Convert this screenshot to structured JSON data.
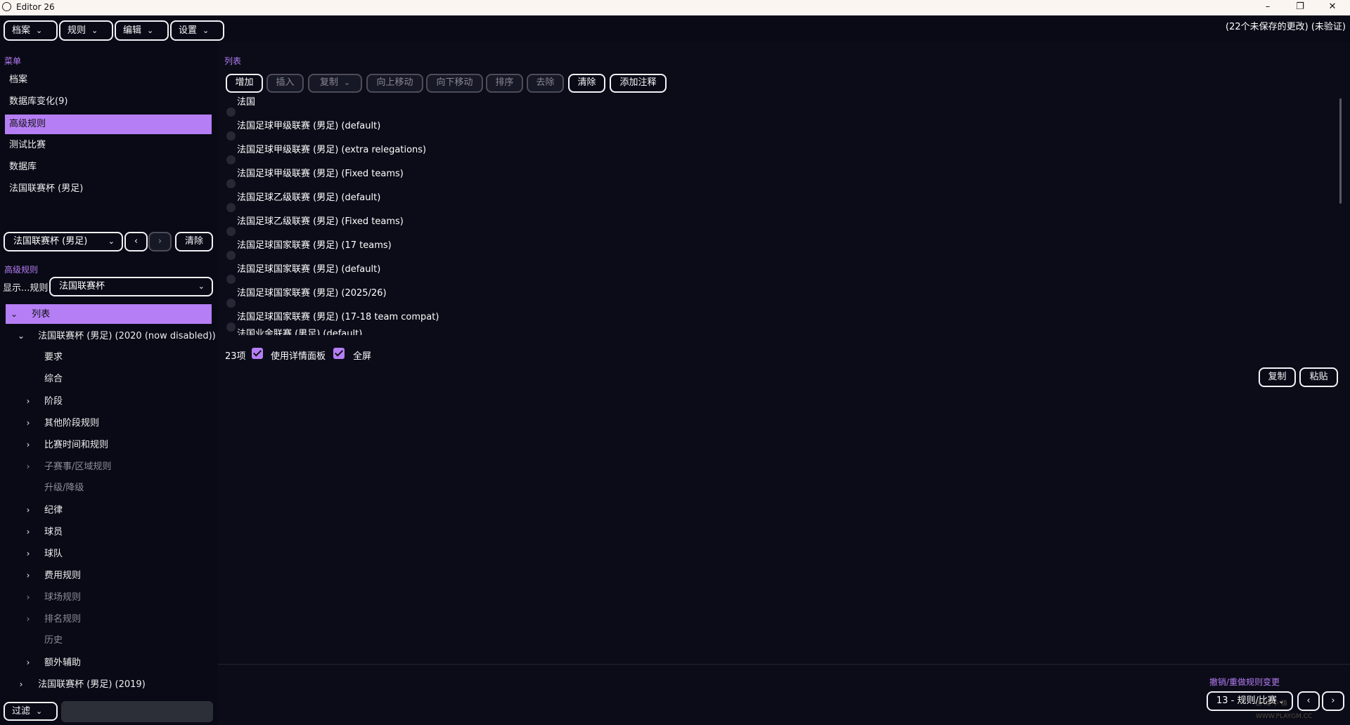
{
  "window": {
    "title": "Editor 26",
    "minimize": "–",
    "maximize": "❐",
    "close": "✕"
  },
  "menubar": {
    "buttons": [
      "档案",
      "规则",
      "编辑",
      "设置"
    ],
    "status": "(22个未保存的更改) (未验证)"
  },
  "left": {
    "menu_section": "菜单",
    "menu_items": [
      "档案",
      "数据库变化(9)",
      "高级规则",
      "测试比赛",
      "数据库",
      "法国联赛杯 (男足)"
    ],
    "selected_menu_index": 2,
    "nav_selector": "法国联赛杯 (男足)",
    "nav_prev": "‹",
    "nav_next": "›",
    "clear_button": "清除",
    "advanced_section": "高级规则",
    "show_rule_label": "显示...规则",
    "show_rule_value": "法国联赛杯",
    "tree": {
      "root": "列表",
      "node1": "法国联赛杯 (男足) (2020 (now disabled))",
      "children": [
        {
          "label": "要求",
          "expandable": false,
          "enabled": true
        },
        {
          "label": "综合",
          "expandable": false,
          "enabled": true
        },
        {
          "label": "阶段",
          "expandable": true,
          "enabled": true
        },
        {
          "label": "其他阶段规则",
          "expandable": true,
          "enabled": true
        },
        {
          "label": "比赛时间和规则",
          "expandable": true,
          "enabled": true
        },
        {
          "label": "子赛事/区域规则",
          "expandable": true,
          "enabled": false
        },
        {
          "label": "升级/降级",
          "expandable": false,
          "enabled": false
        },
        {
          "label": "纪律",
          "expandable": true,
          "enabled": true
        },
        {
          "label": "球员",
          "expandable": true,
          "enabled": true
        },
        {
          "label": "球队",
          "expandable": true,
          "enabled": true
        },
        {
          "label": "费用规则",
          "expandable": true,
          "enabled": true
        },
        {
          "label": "球场规则",
          "expandable": true,
          "enabled": false
        },
        {
          "label": "排名规则",
          "expandable": true,
          "enabled": false
        },
        {
          "label": "历史",
          "expandable": false,
          "enabled": false
        },
        {
          "label": "额外辅助",
          "expandable": true,
          "enabled": true
        }
      ],
      "node2": "法国联赛杯 (男足) (2019)"
    },
    "filter_button": "过滤",
    "filter_value": ""
  },
  "right": {
    "list_section": "列表",
    "toolbar": [
      {
        "label": "增加",
        "enabled": true
      },
      {
        "label": "插入",
        "enabled": false
      },
      {
        "label": "复制",
        "enabled": false,
        "dropdown": true
      },
      {
        "label": "向上移动",
        "enabled": false
      },
      {
        "label": "向下移动",
        "enabled": false
      },
      {
        "label": "排序",
        "enabled": false
      },
      {
        "label": "去除",
        "enabled": false
      },
      {
        "label": "清除",
        "enabled": true
      },
      {
        "label": "添加注释",
        "enabled": true
      }
    ],
    "items": [
      "法国",
      "法国足球甲级联赛 (男足) (default)",
      "法国足球甲级联赛 (男足) (extra relegations)",
      "法国足球甲级联赛 (男足) (Fixed teams)",
      "法国足球乙级联赛 (男足) (default)",
      "法国足球乙级联赛 (男足) (Fixed teams)",
      "法国足球国家联赛 (男足) (17 teams)",
      "法国足球国家联赛 (男足) (default)",
      "法国足球国家联赛 (男足) (2025/26)",
      "法国足球国家联赛 (男足) (17-18 team compat)",
      "法国业余联赛 (男足) (default)"
    ],
    "count": "23项",
    "detail_panel_label": "使用详情面板",
    "detail_panel_checked": true,
    "fullscreen_label": "全屏",
    "fullscreen_checked": true,
    "copy_button": "复制",
    "paste_button": "粘贴",
    "undo_label": "撤销/重做规则变更",
    "history_select": "13 - 规则/比赛",
    "watermark": "游 戏 小 镇 WWW.PLAYGM.CC"
  },
  "colors": {
    "accent": "#b57ef5",
    "background": "#090a16",
    "label_accent": "#b67cf4"
  },
  "icons": {
    "dropdown": "chevron-down-icon",
    "tree_expand": "chevron-right-icon",
    "tree_collapse": "chevron-down-icon"
  }
}
